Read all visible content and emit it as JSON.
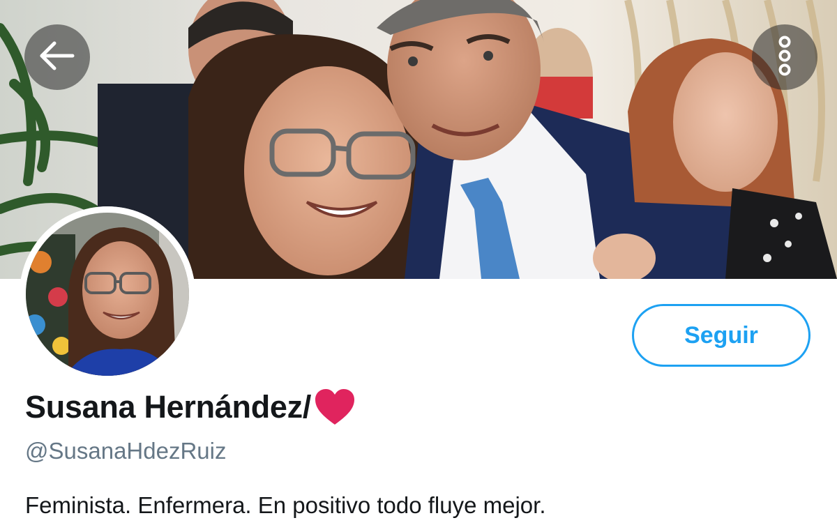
{
  "header": {
    "back_icon": "arrow-left-icon",
    "more_icon": "more-vertical-icon"
  },
  "profile": {
    "display_name": "Susana Hernández/",
    "name_emoji_icon": "red-heart-icon",
    "handle": "@SusanaHdezRuiz",
    "bio": "Feminista. Enfermera. En positivo todo fluye mejor."
  },
  "actions": {
    "follow_label": "Seguir"
  },
  "colors": {
    "accent": "#1da1f2",
    "heart": "#e0245e",
    "text_primary": "#14171a",
    "text_secondary": "#657786"
  }
}
